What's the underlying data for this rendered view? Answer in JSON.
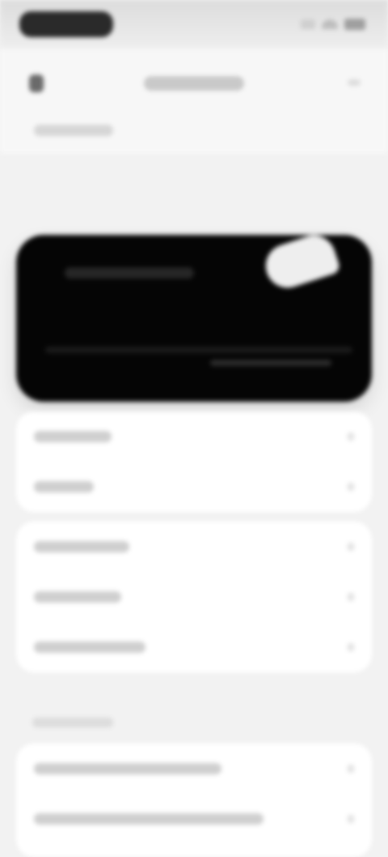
{
  "status_bar": {
    "time": "",
    "icons": [
      "signal-icon",
      "wifi-icon",
      "battery-icon"
    ]
  },
  "header": {
    "title": "",
    "subtitle": "",
    "icons": [
      "back-arrow-icon",
      "menu-icon"
    ]
  },
  "hero_card": {
    "title": "",
    "subtitle": ""
  },
  "group1": {
    "items": [
      {
        "label": ""
      },
      {
        "label": ""
      }
    ]
  },
  "group2": {
    "items": [
      {
        "label": ""
      },
      {
        "label": ""
      },
      {
        "label": ""
      }
    ]
  },
  "section": {
    "title": ""
  },
  "group3": {
    "items": [
      {
        "label": ""
      },
      {
        "label": ""
      }
    ]
  },
  "colors": {
    "background": "#f2f2f2",
    "card": "#ffffff",
    "hero": "#050505",
    "text_placeholder": "#cfcfcf"
  }
}
